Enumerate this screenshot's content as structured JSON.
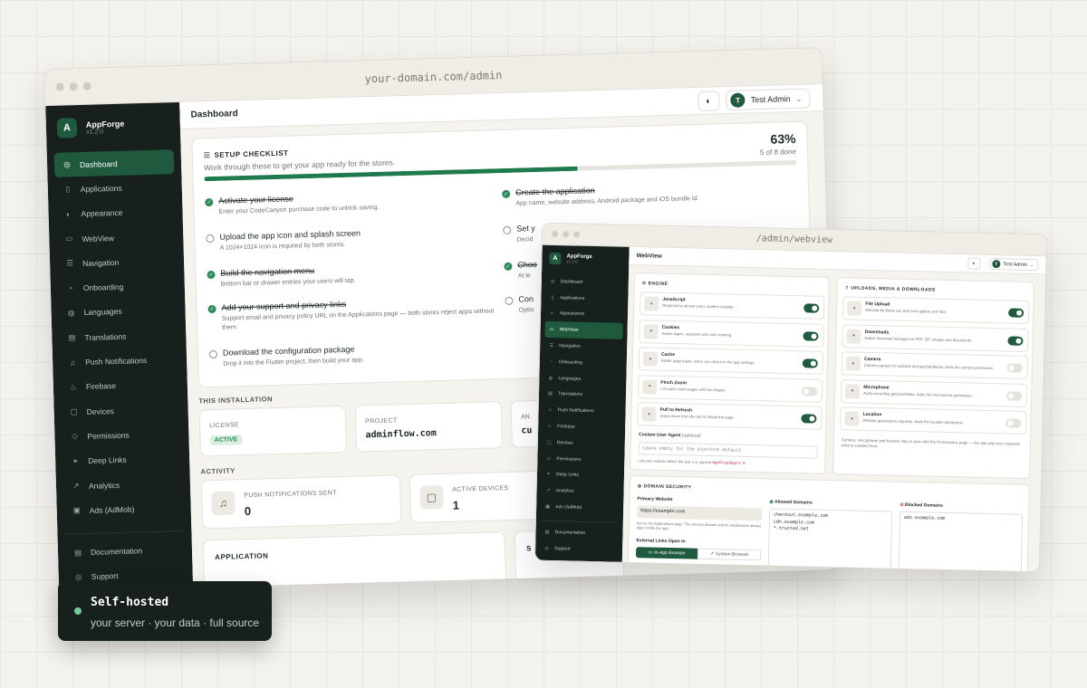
{
  "main_window": {
    "url": "your-domain.com/admin",
    "brand": {
      "name": "AppForge",
      "version": "v1.2.0",
      "initial": "A"
    },
    "nav": [
      {
        "label": "Dashboard",
        "icon": "dashboard-icon",
        "glyph": "◎",
        "active": true
      },
      {
        "label": "Applications",
        "icon": "phone-icon",
        "glyph": "▯"
      },
      {
        "label": "Appearance",
        "icon": "palette-icon",
        "glyph": "◐"
      },
      {
        "label": "WebView",
        "icon": "browser-icon",
        "glyph": "▭"
      },
      {
        "label": "Navigation",
        "icon": "list-icon",
        "glyph": "☰"
      },
      {
        "label": "Onboarding",
        "icon": "flag-icon",
        "glyph": "◔"
      },
      {
        "label": "Languages",
        "icon": "globe-icon",
        "glyph": "◍"
      },
      {
        "label": "Translations",
        "icon": "translate-icon",
        "glyph": "▤"
      },
      {
        "label": "Push Notifications",
        "icon": "bell-icon",
        "glyph": "♫"
      },
      {
        "label": "Firebase",
        "icon": "flame-icon",
        "glyph": "♨"
      },
      {
        "label": "Devices",
        "icon": "device-icon",
        "glyph": "▢"
      },
      {
        "label": "Permissions",
        "icon": "shield-icon",
        "glyph": "◇"
      },
      {
        "label": "Deep Links",
        "icon": "link-icon",
        "glyph": "⚭"
      },
      {
        "label": "Analytics",
        "icon": "chart-icon",
        "glyph": "↗"
      },
      {
        "label": "Ads (AdMob)",
        "icon": "ad-icon",
        "glyph": "▣"
      }
    ],
    "footer_nav": [
      {
        "label": "Documentation",
        "icon": "book-icon",
        "glyph": "▤"
      },
      {
        "label": "Support",
        "icon": "lifebuoy-icon",
        "glyph": "◎"
      }
    ],
    "header": {
      "title": "Dashboard",
      "user": "Test Admin",
      "user_initial": "T"
    },
    "checklist": {
      "title": "SETUP CHECKLIST",
      "subtitle": "Work through these to get your app ready for the stores.",
      "percent": "63%",
      "progress": 0.63,
      "done_label": "5 of 8 done",
      "items": [
        {
          "title": "Activate your license",
          "desc": "Enter your CodeCanyon purchase code to unlock saving.",
          "done": true
        },
        {
          "title": "Upload the app icon and splash screen",
          "desc": "A 1024×1024 icon is required by both stores.",
          "done": false
        },
        {
          "title": "Build the navigation menu",
          "desc": "Bottom bar or drawer entries your users will tap.",
          "done": true
        },
        {
          "title": "Add your support and privacy links",
          "desc": "Support email and privacy policy URL on the Applications page — both stores reject apps without them.",
          "done": true
        },
        {
          "title": "Download the configuration package",
          "desc": "Drop it into the Flutter project, then build your app.",
          "done": false
        },
        {
          "title": "Create the application",
          "desc": "App name, website address, Android package and iOS bundle id.",
          "done": true
        },
        {
          "title": "Set y",
          "desc": "Decid",
          "done": false
        },
        {
          "title": "Choo",
          "desc": "At le",
          "done": true
        },
        {
          "title": "Con",
          "desc": "Optio",
          "done": false
        }
      ]
    },
    "installation": {
      "heading": "THIS INSTALLATION",
      "license_label": "LICENSE",
      "license_value": "ACTIVE",
      "project_label": "PROJECT",
      "project_value": "adminflow.com",
      "third_label": "AN",
      "third_value": "cu"
    },
    "activity": {
      "heading": "ACTIVITY",
      "push_label": "PUSH NOTIFICATIONS SENT",
      "push_value": "0",
      "devices_label": "ACTIVE DEVICES",
      "devices_value": "1"
    },
    "application": {
      "heading": "APPLICATION",
      "side_heading": "S"
    }
  },
  "webview_window": {
    "url": "/admin/webview",
    "brand": {
      "name": "AppForge",
      "version": "v1.2.0",
      "initial": "A"
    },
    "nav": [
      {
        "label": "Dashboard",
        "glyph": "◎"
      },
      {
        "label": "Applications",
        "glyph": "▯"
      },
      {
        "label": "Appearance",
        "glyph": "◐"
      },
      {
        "label": "WebView",
        "glyph": "▭",
        "active": true
      },
      {
        "label": "Navigation",
        "glyph": "☰"
      },
      {
        "label": "Onboarding",
        "glyph": "◔"
      },
      {
        "label": "Languages",
        "glyph": "◍"
      },
      {
        "label": "Translations",
        "glyph": "▤"
      },
      {
        "label": "Push Notifications",
        "glyph": "♫"
      },
      {
        "label": "Firebase",
        "glyph": "♨"
      },
      {
        "label": "Devices",
        "glyph": "▢"
      },
      {
        "label": "Permissions",
        "glyph": "◇"
      },
      {
        "label": "Deep Links",
        "glyph": "⚭"
      },
      {
        "label": "Analytics",
        "glyph": "↗"
      },
      {
        "label": "Ads (AdMob)",
        "glyph": "▣"
      }
    ],
    "footer_nav": [
      {
        "label": "Documentation",
        "glyph": "▤"
      },
      {
        "label": "Support",
        "glyph": "◎"
      }
    ],
    "header": {
      "title": "WebView",
      "user": "Test Admin",
      "user_initial": "T"
    },
    "engine": {
      "heading": "ENGINE",
      "items": [
        {
          "title": "JavaScript",
          "desc": "Required by almost every modern website.",
          "on": true
        },
        {
          "title": "Cookies",
          "desc": "Keeps logins, sessions and carts working.",
          "on": true
        },
        {
          "title": "Cache",
          "desc": "Faster page loads; users can clear it in the app settings.",
          "on": true
        },
        {
          "title": "Pinch Zoom",
          "desc": "Let users zoom pages with two fingers.",
          "on": false
        },
        {
          "title": "Pull to Refresh",
          "desc": "Swipe down from the top to reload the page.",
          "on": true
        }
      ],
      "ua_label": "Custom User Agent",
      "ua_optional": "(optional)",
      "ua_placeholder": "Leave empty for the platform default",
      "ua_help": "Lets your website detect the app, e.g. append",
      "ua_token": "AppForgeApp/1.0"
    },
    "uploads": {
      "heading": "UPLOADS, MEDIA & DOWNLOADS",
      "items": [
        {
          "title": "File Upload",
          "desc": "Website file fields can pick from gallery and files.",
          "on": true
        },
        {
          "title": "Downloads",
          "desc": "Native download manager for PDF, ZIP, images and documents.",
          "on": true
        },
        {
          "title": "Camera",
          "desc": "Camera capture for uploads and getUserMedia. Adds the camera permission.",
          "on": false
        },
        {
          "title": "Microphone",
          "desc": "Audio recording getUserMedia. Adds the microphone permission.",
          "on": false
        },
        {
          "title": "Location",
          "desc": "Website geolocation requests. Adds the location permission.",
          "on": false
        }
      ],
      "note": "Camera, microphone and location stay in sync with the Permissions page — the app only ever requests what is enabled here."
    },
    "domain": {
      "heading": "DOMAIN SECURITY",
      "primary_label": "Primary Website",
      "primary_value": "https://example.com",
      "primary_help": "Set on the Applications page. The primary domain and its subdomains always open inside the app.",
      "allowed_label": "Allowed Domains",
      "allowed_value": "checkout.example.com\ncdn.example.com\n*.trusted.net",
      "blocked_label": "Blocked Domains",
      "blocked_value": "ads.example.com",
      "external_label": "External Links Open In",
      "btn_inapp": "In-App Browser",
      "btn_system": "System Browser"
    }
  },
  "badge": {
    "title": "Self-hosted",
    "subtitle": "your server · your data · full source"
  }
}
